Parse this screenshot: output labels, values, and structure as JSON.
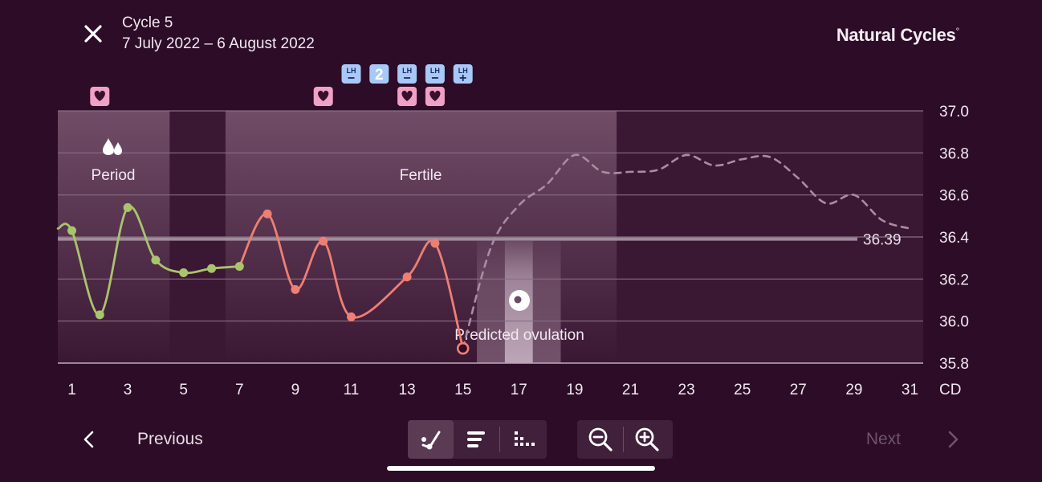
{
  "header": {
    "close_icon": "close-icon",
    "cycle_title": "Cycle 5",
    "date_range": "7 July 2022 – 6 August 2022",
    "brand": "Natural Cycles",
    "brand_mark": "°"
  },
  "colors": {
    "background": "#2c0c27",
    "period_series": "#a9c46c",
    "fertile_series": "#ee7f73",
    "prediction": "#a98ba3",
    "heart_badge": "#f0a1c6",
    "lh_badge": "#a8c8f8",
    "cover_line": "#a896a3"
  },
  "phases": {
    "period": {
      "label": "Period",
      "icon": "blood-drops-icon",
      "start_day": 1,
      "end_day": 4
    },
    "fertile": {
      "label": "Fertile",
      "start_day": 7,
      "end_day": 20
    },
    "predicted_ovulation": {
      "label": "Predicted ovulation",
      "icon": "egg-icon",
      "start_day": 16,
      "end_day": 18,
      "peak_day": 17
    }
  },
  "markers": {
    "hearts": [
      2,
      10,
      13,
      14
    ],
    "lh_tests": [
      {
        "day": 11,
        "result": "negative",
        "text": "LH"
      },
      {
        "day": 13,
        "result": "negative",
        "text": "LH"
      },
      {
        "day": 14,
        "result": "negative",
        "text": "LH"
      },
      {
        "day": 15,
        "result": "positive",
        "text": "LH"
      }
    ],
    "count_badge": {
      "day": 12,
      "text": "2"
    }
  },
  "chart_data": {
    "type": "line",
    "x_unit": "CD",
    "ylim": [
      35.8,
      37.0
    ],
    "xlim": [
      1,
      31
    ],
    "y_ticks": [
      "37.0",
      "36.8",
      "36.6",
      "36.4",
      "36.2",
      "36.0",
      "35.8"
    ],
    "x_ticks": [
      "1",
      "3",
      "5",
      "7",
      "9",
      "11",
      "13",
      "15",
      "17",
      "19",
      "21",
      "23",
      "25",
      "27",
      "29",
      "31"
    ],
    "x_unit_label": "CD",
    "cover_line": {
      "value": 36.39,
      "label": "36.39"
    },
    "series": [
      {
        "phase": "period",
        "points": [
          [
            0.5,
            36.44
          ],
          [
            1,
            36.43
          ],
          [
            2,
            36.03
          ],
          [
            3,
            36.54
          ],
          [
            4,
            36.29
          ],
          [
            5,
            36.23
          ],
          [
            6,
            36.25
          ],
          [
            7,
            36.26
          ]
        ]
      },
      {
        "phase": "fertile",
        "points": [
          [
            7,
            36.26
          ],
          [
            8,
            36.51
          ],
          [
            9,
            36.15
          ],
          [
            10,
            36.38
          ],
          [
            11,
            36.02
          ],
          [
            13,
            36.21
          ],
          [
            14,
            36.37
          ],
          [
            15,
            35.87
          ]
        ]
      },
      {
        "phase": "prediction",
        "points": [
          [
            15,
            35.87
          ],
          [
            16,
            36.35
          ],
          [
            17,
            36.55
          ],
          [
            18,
            36.65
          ],
          [
            19,
            36.79
          ],
          [
            20,
            36.71
          ],
          [
            21,
            36.71
          ],
          [
            22,
            36.72
          ],
          [
            23,
            36.79
          ],
          [
            24,
            36.74
          ],
          [
            25,
            36.77
          ],
          [
            26,
            36.78
          ],
          [
            27,
            36.68
          ],
          [
            28,
            36.56
          ],
          [
            29,
            36.6
          ],
          [
            30,
            36.48
          ],
          [
            31,
            36.44
          ]
        ]
      }
    ]
  },
  "footer": {
    "prev_label": "Previous",
    "next_label": "Next",
    "view_graph_icon": "graph-view-icon",
    "view_list_icon": "list-view-icon",
    "view_dots_icon": "dots-view-icon",
    "zoom_out_icon": "zoom-out-icon",
    "zoom_in_icon": "zoom-in-icon"
  }
}
